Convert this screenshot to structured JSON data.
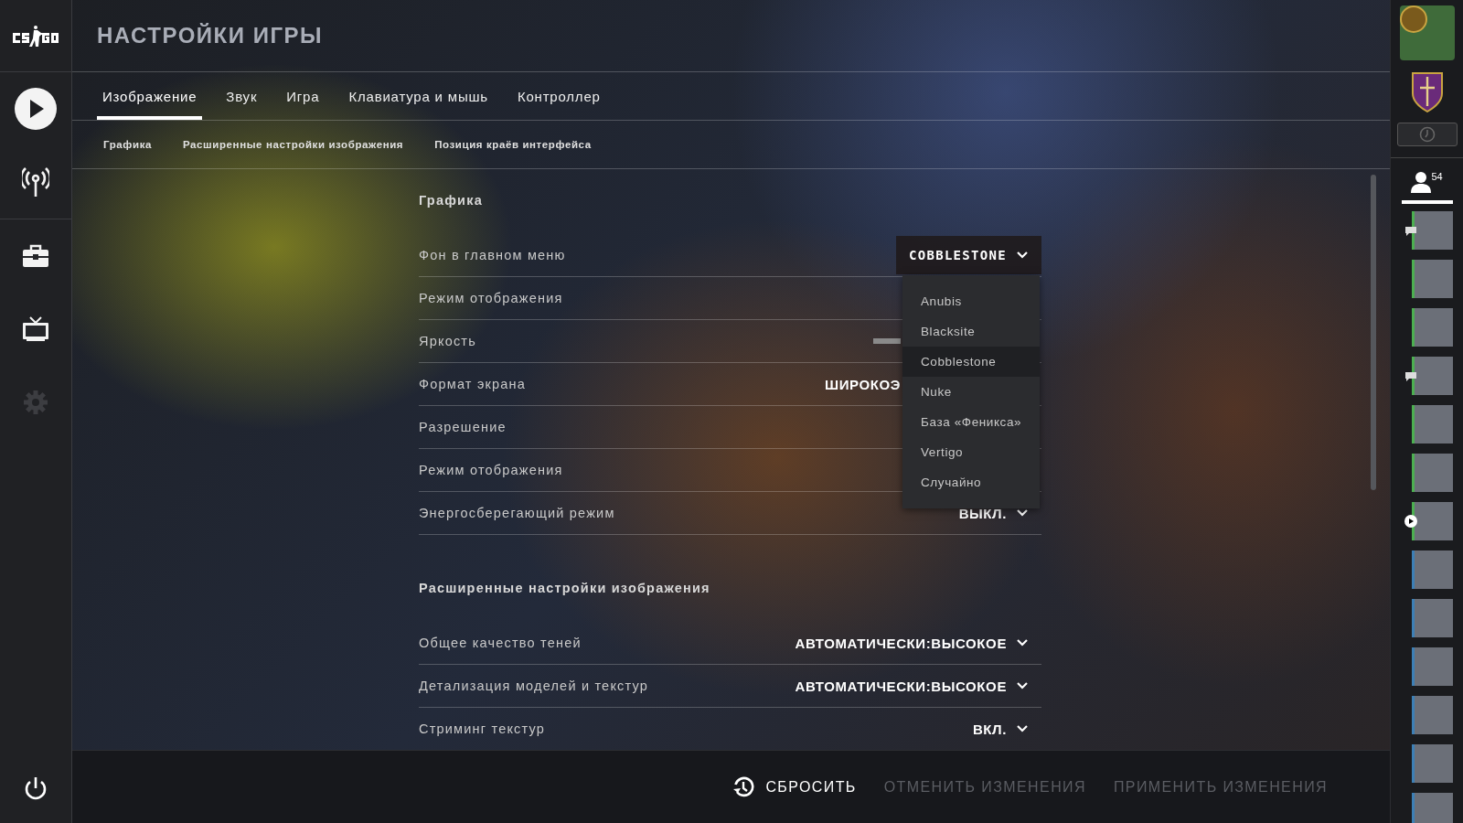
{
  "header": {
    "title": "НАСТРОЙКИ ИГРЫ"
  },
  "nav": {
    "items": [
      {
        "kind": "play",
        "disabled": false
      },
      {
        "kind": "antenna",
        "disabled": false
      },
      {
        "kind": "briefcase",
        "disabled": false
      },
      {
        "kind": "tv",
        "disabled": false
      },
      {
        "kind": "gear",
        "disabled": true
      }
    ]
  },
  "tabs": [
    {
      "label": "Изображение",
      "selected": true
    },
    {
      "label": "Звук",
      "selected": false
    },
    {
      "label": "Игра",
      "selected": false
    },
    {
      "label": "Клавиатура и мышь",
      "selected": false
    },
    {
      "label": "Контроллер",
      "selected": false
    }
  ],
  "subtabs": [
    "Графика",
    "Расширенные настройки изображения",
    "Позиция краёв интерфейса"
  ],
  "sections": [
    {
      "title": "Графика",
      "rows": [
        {
          "label": "Фон в главном меню",
          "kind": "dropdown",
          "value": "COBBLESTONE",
          "open": true
        },
        {
          "label": "Режим отображения",
          "kind": "hidden"
        },
        {
          "label": "Яркость",
          "kind": "slider"
        },
        {
          "label": "Формат экрана",
          "kind": "cut",
          "value": "ШИРОКОЭ"
        },
        {
          "label": "Разрешение",
          "kind": "hidden"
        },
        {
          "label": "Режим отображения",
          "kind": "hidden"
        },
        {
          "label": "Энергосберегающий режим",
          "kind": "dropdown",
          "value": "ВЫКЛ.",
          "open": false
        }
      ]
    },
    {
      "title": "Расширенные настройки изображения",
      "rows": [
        {
          "label": "Общее качество теней",
          "kind": "dropdown",
          "value": "АВТОМАТИЧЕСКИ:ВЫСОКОЕ",
          "open": false
        },
        {
          "label": "Детализация моделей и текстур",
          "kind": "dropdown",
          "value": "АВТОМАТИЧЕСКИ:ВЫСОКОЕ",
          "open": false
        },
        {
          "label": "Стриминг текстур",
          "kind": "dropdown",
          "value": "ВКЛ.",
          "open": false
        }
      ]
    }
  ],
  "menu": {
    "items": [
      {
        "label": "Anubis",
        "selected": false
      },
      {
        "label": "Blacksite",
        "selected": false
      },
      {
        "label": "Cobblestone",
        "selected": true
      },
      {
        "label": "Nuke",
        "selected": false
      },
      {
        "label": "База «Феникса»",
        "selected": false
      },
      {
        "label": "Vertigo",
        "selected": false
      },
      {
        "label": "Случайно",
        "selected": false
      }
    ]
  },
  "footer": {
    "buttons": [
      {
        "label": "СБРОСИТЬ",
        "disabled": false,
        "kind": "reset"
      },
      {
        "label": "ОТМЕНИТЬ ИЗМЕНЕНИЯ",
        "disabled": true,
        "kind": "plain"
      },
      {
        "label": "ПРИМЕНИТЬ ИЗМЕНЕНИЯ",
        "disabled": true,
        "kind": "plain"
      }
    ]
  },
  "friends": {
    "count": "54",
    "list": [
      {
        "color": "#4caf50",
        "kind": "chat"
      },
      {
        "color": "#4caf50",
        "kind": "plain"
      },
      {
        "color": "#4caf50",
        "kind": "plain"
      },
      {
        "color": "#4caf50",
        "kind": "chat"
      },
      {
        "color": "#4caf50",
        "kind": "plain"
      },
      {
        "color": "#4caf50",
        "kind": "plain"
      },
      {
        "color": "#4caf50",
        "kind": "play"
      },
      {
        "color": "#3d7fb5",
        "kind": "plain"
      },
      {
        "color": "#3d7fb5",
        "kind": "plain"
      },
      {
        "color": "#3d7fb5",
        "kind": "plain"
      },
      {
        "color": "#3d7fb5",
        "kind": "plain"
      },
      {
        "color": "#3d7fb5",
        "kind": "plain"
      },
      {
        "color": "#3d7fb5",
        "kind": "plain"
      }
    ]
  }
}
